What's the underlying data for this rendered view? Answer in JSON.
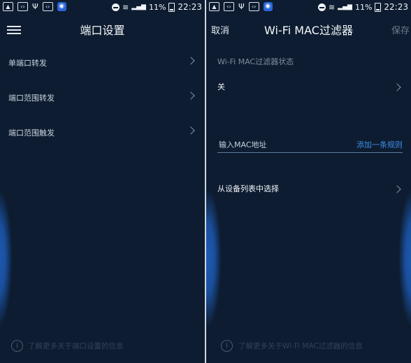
{
  "status_bar": {
    "battery": "11%",
    "time": "22:23"
  },
  "left": {
    "title": "端口设置",
    "menu": [
      {
        "label": "单端口转发"
      },
      {
        "label": "端口范围转发"
      },
      {
        "label": "端口范围触发"
      }
    ],
    "footer": "了解更多关于端口设置的信息"
  },
  "right": {
    "title": "Wi-Fi MAC过滤器",
    "cancel": "取消",
    "save": "保存",
    "status_label": "Wi-Fi MAC过滤器状态",
    "status_value": "关",
    "mac_placeholder": "输入MAC地址",
    "add_rule": "添加一条规则",
    "choose_device": "从设备列表中选择",
    "footer": "了解更多关于Wi-Fi MAC过滤器的信息"
  },
  "colors": {
    "background": "#0d1c30",
    "accent": "#3d8ee8",
    "save_disabled": "#6c7b8d"
  }
}
